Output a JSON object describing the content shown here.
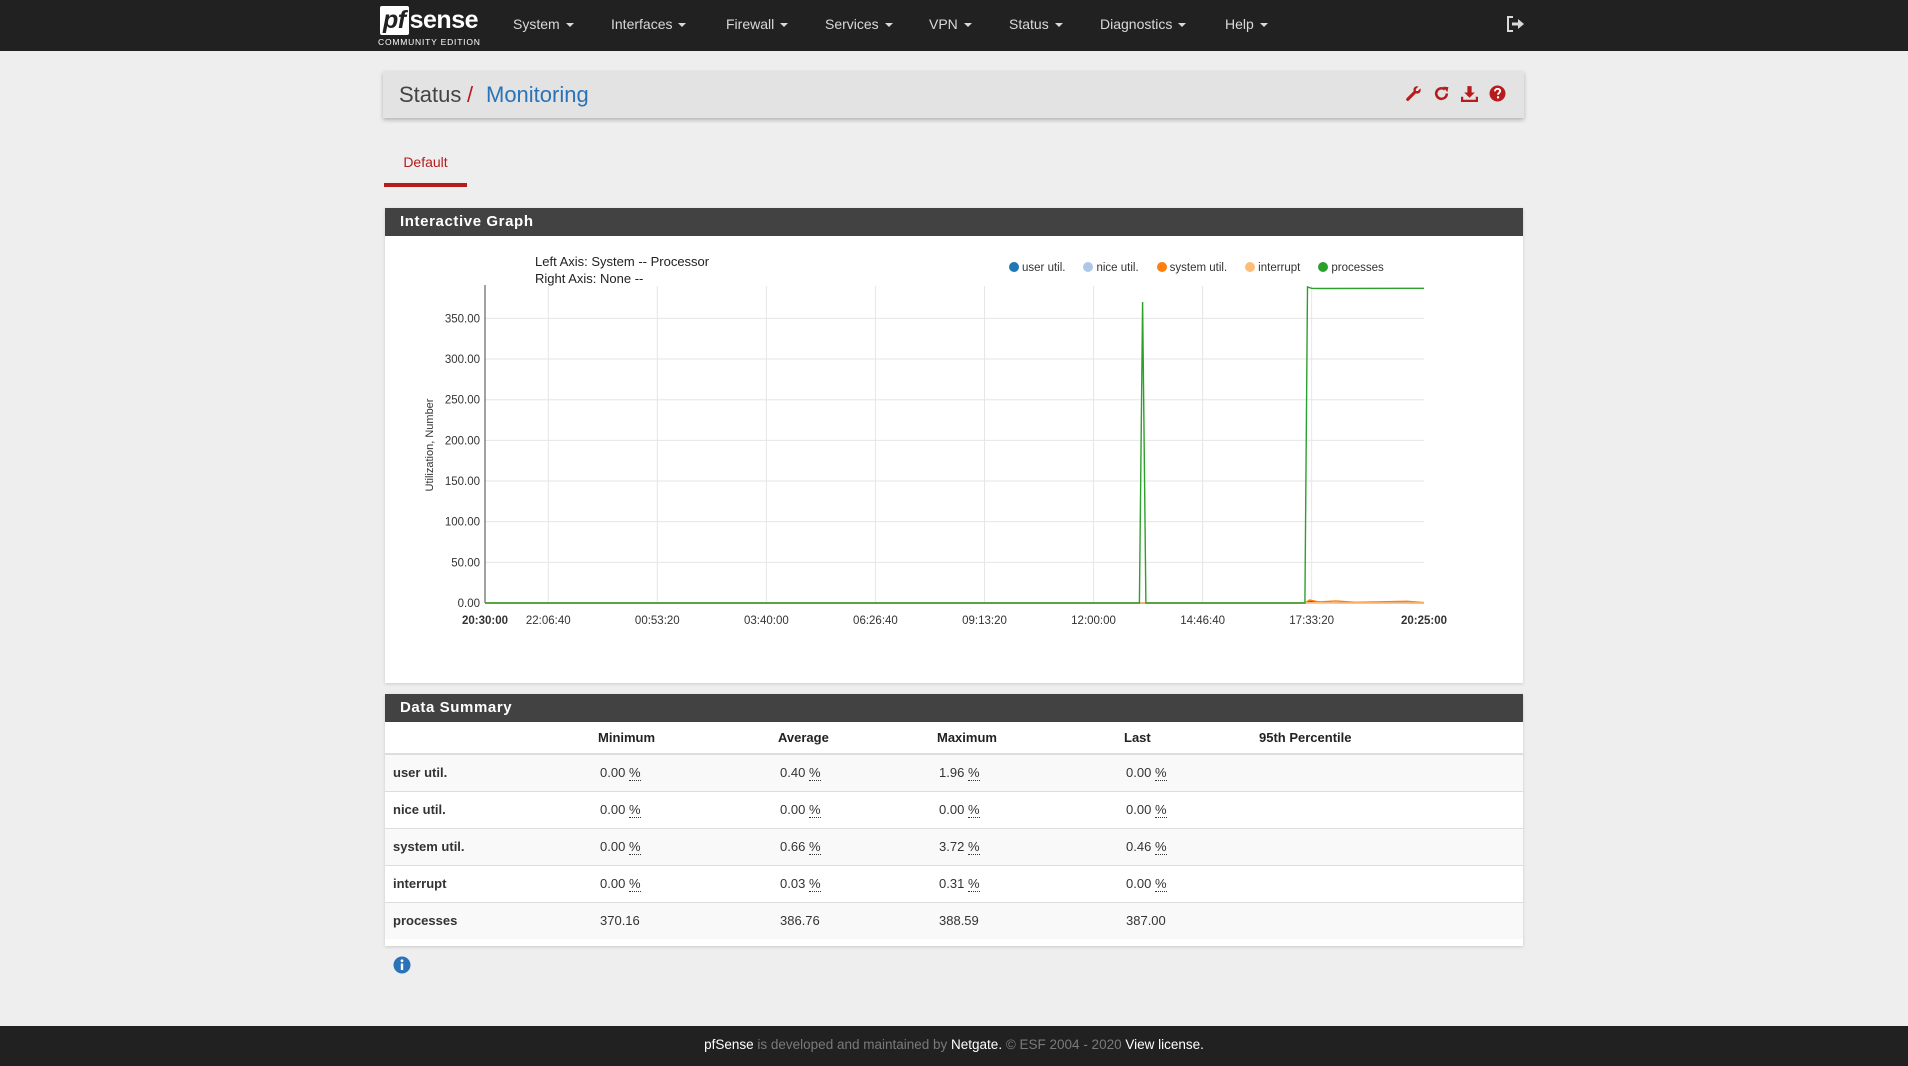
{
  "brand": {
    "logo_pf": "pf",
    "logo_sense": "sense",
    "edition": "COMMUNITY EDITION"
  },
  "nav": {
    "items": [
      {
        "label": "System"
      },
      {
        "label": "Interfaces"
      },
      {
        "label": "Firewall"
      },
      {
        "label": "Services"
      },
      {
        "label": "VPN"
      },
      {
        "label": "Status"
      },
      {
        "label": "Diagnostics"
      },
      {
        "label": "Help"
      }
    ],
    "logout_icon": "sign-out-icon"
  },
  "breadcrumb": {
    "parent": "Status",
    "separator": "/",
    "current": "Monitoring",
    "icons": [
      "wrench-icon",
      "refresh-icon",
      "download-icon",
      "help-icon"
    ]
  },
  "tabs": [
    {
      "label": "Default",
      "active": true
    }
  ],
  "graph_panel": {
    "title": "Interactive Graph",
    "left_axis": "Left Axis: System -- Processor",
    "right_axis": "Right Axis: None --"
  },
  "chart_data": {
    "type": "line",
    "ylabel": "Utilization, Number",
    "ylim": [
      0,
      388.59
    ],
    "yticks": [
      "0.00",
      "50.00",
      "100.00",
      "150.00",
      "200.00",
      "250.00",
      "300.00",
      "350.00"
    ],
    "x_tick_labels": [
      "20:30:00",
      "22:06:40",
      "00:53:20",
      "03:40:00",
      "06:26:40",
      "09:13:20",
      "12:00:00",
      "14:46:40",
      "17:33:20",
      "20:25:00"
    ],
    "x_start": "20:30:00",
    "x_end": "20:25:00",
    "grid": true,
    "legend_position": "top-right",
    "series": [
      {
        "name": "user util.",
        "color": "#1f77b4",
        "x": [
          "20:30:00",
          "17:23:00",
          "17:30:00",
          "18:00:00",
          "19:00:00",
          "20:25:00"
        ],
        "y": [
          0.0,
          0.0,
          1.96,
          0.4,
          0.5,
          0.0
        ]
      },
      {
        "name": "nice util.",
        "color": "#aec7e8",
        "x": [
          "20:30:00",
          "20:25:00"
        ],
        "y": [
          0.0,
          0.0
        ]
      },
      {
        "name": "system util.",
        "color": "#ff7f0e",
        "x": [
          "20:30:00",
          "17:23:00",
          "17:30:00",
          "17:45:00",
          "18:10:00",
          "18:40:00",
          "19:20:00",
          "20:00:00",
          "20:25:00"
        ],
        "y": [
          0.0,
          0.0,
          3.72,
          1.2,
          2.6,
          0.8,
          1.5,
          2.1,
          0.46
        ]
      },
      {
        "name": "interrupt",
        "color": "#ffbb78",
        "x": [
          "20:30:00",
          "17:23:00",
          "17:40:00",
          "18:30:00",
          "20:25:00"
        ],
        "y": [
          0.0,
          0.0,
          0.31,
          0.05,
          0.0
        ]
      },
      {
        "name": "processes",
        "color": "#2ca02c",
        "x": [
          "20:30:00",
          "13:10:00",
          "13:15:00",
          "13:20:00",
          "13:25:00",
          "17:23:00",
          "17:27:00",
          "17:33:00",
          "17:50:00",
          "20:25:00"
        ],
        "y": [
          0.0,
          0.0,
          370.16,
          0.0,
          0.0,
          0.0,
          388.59,
          387.0,
          386.76,
          387.0
        ]
      }
    ]
  },
  "summary": {
    "title": "Data Summary",
    "columns": [
      "",
      "Minimum",
      "Average",
      "Maximum",
      "Last",
      "95th Percentile"
    ],
    "rows": [
      {
        "label": "user util.",
        "min": "0.00",
        "avg": "0.40",
        "max": "1.96",
        "last": "0.00",
        "unit": "%"
      },
      {
        "label": "nice util.",
        "min": "0.00",
        "avg": "0.00",
        "max": "0.00",
        "last": "0.00",
        "unit": "%"
      },
      {
        "label": "system util.",
        "min": "0.00",
        "avg": "0.66",
        "max": "3.72",
        "last": "0.46",
        "unit": "%"
      },
      {
        "label": "interrupt",
        "min": "0.00",
        "avg": "0.03",
        "max": "0.31",
        "last": "0.00",
        "unit": "%"
      },
      {
        "label": "processes",
        "min": "370.16",
        "avg": "386.76",
        "max": "388.59",
        "last": "387.00",
        "unit": ""
      }
    ]
  },
  "info_icon": "info-circle-icon",
  "footer": {
    "pfsense": "pfSense",
    "mid": " is developed and maintained by ",
    "netgate": "Netgate.",
    "copy": " © ESF 2004 - 2020 ",
    "license": "View license."
  },
  "colors": {
    "accent": "#b71c1c",
    "link": "#2a73b8",
    "navbar": "#212121",
    "panel_head": "#424242"
  }
}
